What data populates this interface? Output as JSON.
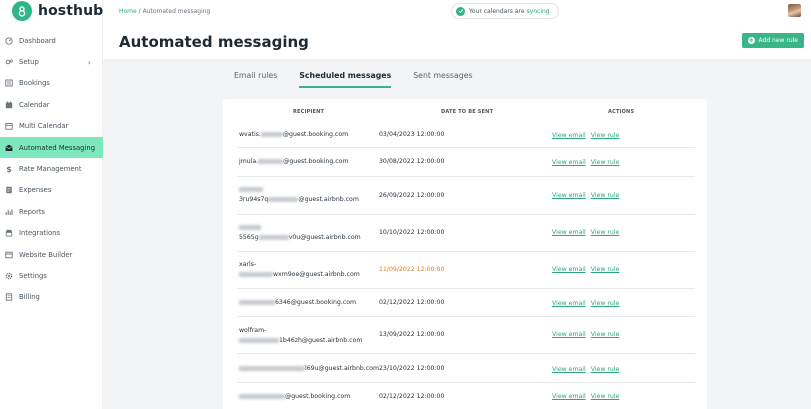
{
  "app": {
    "name": "hosthub"
  },
  "sidebar": {
    "items": [
      {
        "label": "Dashboard",
        "icon": "dashboard-icon"
      },
      {
        "label": "Setup",
        "icon": "setup-icon",
        "chevron": "›"
      },
      {
        "label": "Bookings",
        "icon": "bookings-icon"
      },
      {
        "label": "Calendar",
        "icon": "calendar-icon"
      },
      {
        "label": "Multi Calendar",
        "icon": "multi-calendar-icon"
      },
      {
        "label": "Automated Messaging",
        "icon": "messaging-icon",
        "active": true
      },
      {
        "label": "Rate Management",
        "icon": "dollar-icon"
      },
      {
        "label": "Expenses",
        "icon": "expenses-icon"
      },
      {
        "label": "Reports",
        "icon": "reports-icon"
      },
      {
        "label": "Integrations",
        "icon": "integrations-icon"
      },
      {
        "label": "Website Builder",
        "icon": "website-icon"
      },
      {
        "label": "Settings",
        "icon": "settings-icon"
      },
      {
        "label": "Billing",
        "icon": "billing-icon"
      }
    ]
  },
  "topbar": {
    "breadcrumb_home": "Home",
    "breadcrumb_sep": "/",
    "breadcrumb_current": "Automated messaging",
    "sync_text": "Your calendars are",
    "sync_status": "syncing"
  },
  "header": {
    "title": "Automated messaging",
    "add_button": "Add new rule"
  },
  "tabs": [
    {
      "label": "Email rules",
      "active": false
    },
    {
      "label": "Scheduled messages",
      "active": true
    },
    {
      "label": "Sent messages",
      "active": false
    }
  ],
  "table": {
    "headers": {
      "recipient": "RECIPIENT",
      "date": "DATE TO BE SENT",
      "actions": "ACTIONS"
    },
    "action_labels": {
      "view_email": "View email",
      "view_rule": "View rule"
    },
    "rows": [
      {
        "recipient_line1": "wvatis.",
        "recipient_line1_suffix": "@guest.booking.com",
        "recipient_line2": "",
        "date": "03/04/2023 12:00:00",
        "date_color": "normal"
      },
      {
        "recipient_line1": "jmula.",
        "recipient_line1_suffix": "@guest.booking.com",
        "recipient_line2": "",
        "date": "30/08/2022 12:00:00",
        "date_color": "normal"
      },
      {
        "recipient_line1": "",
        "recipient_line1_suffix": "",
        "recipient_line2": "3ru94s7q",
        "recipient_line2_suffix": "@guest.airbnb.com",
        "date": "26/09/2022 12:00:00",
        "date_color": "normal"
      },
      {
        "recipient_line1": "",
        "recipient_line1_suffix": "",
        "recipient_line2": "5565g",
        "recipient_line2_suffix": "v0u@guest.airbnb.com",
        "date": "10/10/2022 12:00:00",
        "date_color": "normal"
      },
      {
        "recipient_line1": "xarls-",
        "recipient_line1_suffix": "",
        "recipient_line2": "",
        "recipient_line2_suffix": "wxm9oe@guest.airbnb.com",
        "date": "11/09/2022 12:00:00",
        "date_color": "orange"
      },
      {
        "recipient_line1": "",
        "recipient_line1_suffix": "6346@guest.booking.com",
        "recipient_line2": "",
        "date": "02/12/2022 12:00:00",
        "date_color": "normal"
      },
      {
        "recipient_line1": "wolfram-",
        "recipient_line1_suffix": "",
        "recipient_line2": "",
        "recipient_line2_suffix": "1b46zh@guest.airbnb.com",
        "date": "13/09/2022 12:00:00",
        "date_color": "normal"
      },
      {
        "recipient_line1": "",
        "recipient_line1_suffix": "l69u@guest.airbnb.com",
        "recipient_line2": "",
        "date": "23/10/2022 12:00:00",
        "date_color": "normal"
      },
      {
        "recipient_line1": "",
        "recipient_line1_suffix": "@guest.booking.com",
        "recipient_line2": "",
        "date": "02/12/2022 12:00:00",
        "date_color": "normal"
      }
    ]
  },
  "colors": {
    "accent": "#39b58a",
    "active_nav": "#7ee8bd",
    "link": "#2fa57a",
    "warning_date": "#e27a1f"
  }
}
